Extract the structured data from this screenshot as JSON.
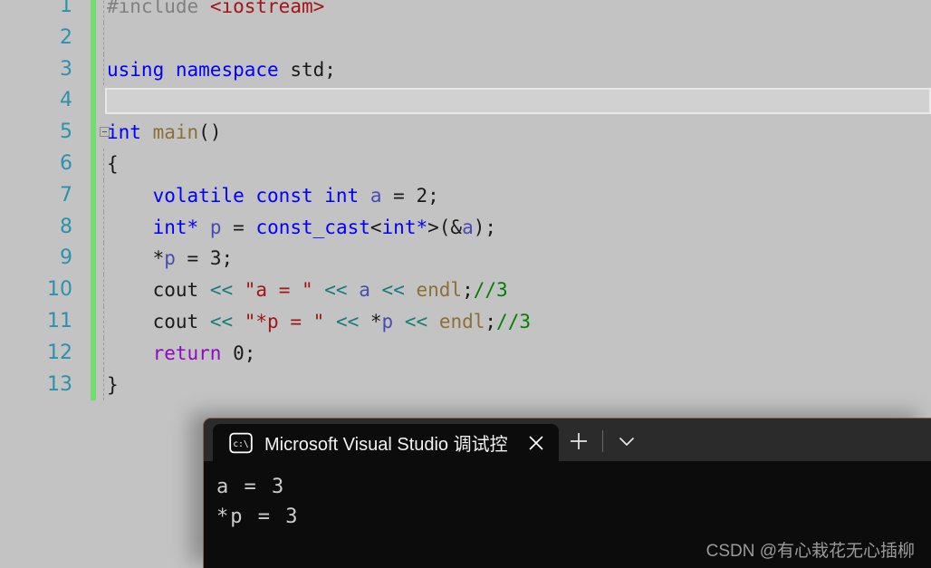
{
  "editor": {
    "name": "visual-studio-code-editor",
    "background_color": "#c3c3c3",
    "gutter_color": "#2b91af",
    "change_bar_color": "#6fdd6f",
    "current_line_number": 4,
    "lines": [
      {
        "num": "1",
        "fold": false
      },
      {
        "num": "2",
        "fold": false
      },
      {
        "num": "3",
        "fold": false
      },
      {
        "num": "4",
        "fold": false
      },
      {
        "num": "5",
        "fold": true
      },
      {
        "num": "6",
        "fold": false
      },
      {
        "num": "7",
        "fold": false
      },
      {
        "num": "8",
        "fold": false
      },
      {
        "num": "9",
        "fold": false
      },
      {
        "num": "10",
        "fold": false
      },
      {
        "num": "11",
        "fold": false
      },
      {
        "num": "12",
        "fold": false
      },
      {
        "num": "13",
        "fold": false
      }
    ],
    "code": {
      "line1": "#include <iostream>",
      "line2": "",
      "line3": "using namespace std;",
      "line4": "",
      "line5": "int main()",
      "line6": "{",
      "line7": "    volatile const int a = 2;",
      "line8": "    int* p = const_cast<int*>(&a);",
      "line9": "    *p = 3;",
      "line10": "    cout << \"a = \" << a << endl;//3",
      "line11": "    cout << \"*p = \" << *p << endl;//3",
      "line12": "    return 0;",
      "line13": "}"
    },
    "tokens": {
      "include_directive": "#include",
      "header": "<iostream>",
      "kw_using": "using",
      "kw_namespace": "namespace",
      "id_std": "std",
      "kw_int": "int",
      "fn_main": "main",
      "paren_empty": "()",
      "brace_open": "{",
      "brace_close": "}",
      "kw_volatile": "volatile",
      "kw_const": "const",
      "var_a": "a",
      "num_2": "2",
      "kw_int_star": "int*",
      "var_p": "p",
      "kw_const_cast": "const_cast",
      "angle_open": "<",
      "angle_close": ">",
      "addr_of_a": "(&a)",
      "deref_p": "*p",
      "num_3": "3",
      "id_cout": "cout",
      "op_shift": "<<",
      "str_a_eq": "\"a = \"",
      "str_p_eq": "\"*p = \"",
      "id_endl": "endl",
      "comment_3": "//3",
      "kw_return": "return",
      "num_0": "0",
      "semicolon": ";",
      "equals": "="
    }
  },
  "console": {
    "name": "microsoft-visual-studio-debug-console",
    "background_color": "#0c0c0c",
    "titlebar_color": "#2b2b2b",
    "border_accent": "#8a5c4d",
    "tab": {
      "icon": "terminal-icon",
      "icon_label": "C:\\",
      "title": "Microsoft Visual Studio 调试控",
      "close_icon": "close-icon"
    },
    "titlebar_buttons": [
      {
        "icon": "plus-icon",
        "name": "new-tab-button"
      },
      {
        "icon": "chevron-down-icon",
        "name": "tab-dropdown-button"
      }
    ],
    "output": [
      "a = 3",
      "*p = 3"
    ]
  },
  "watermark": {
    "text": "CSDN @有心栽花无心插柳",
    "color": "#9a9a9a"
  }
}
